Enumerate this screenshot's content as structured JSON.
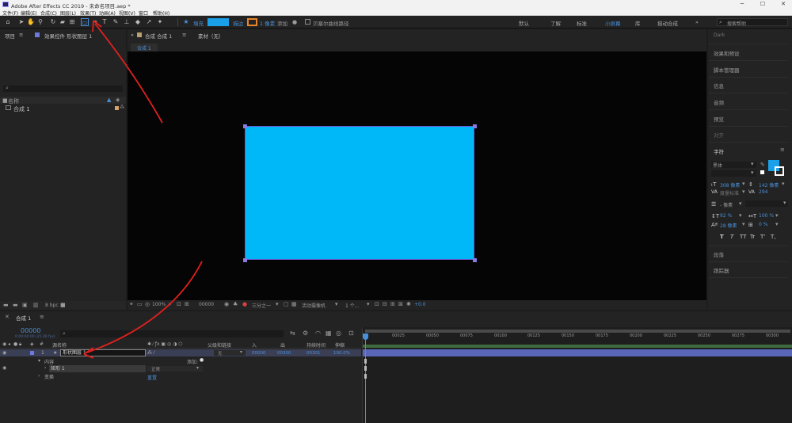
{
  "app": {
    "title": "Adobe After Effects CC 2019 - 未命名项目.aep *",
    "win_min": "─",
    "win_max": "☐",
    "win_close": "✕"
  },
  "menu": [
    "文件(F)",
    "编辑(E)",
    "合成(C)",
    "图层(L)",
    "效果(T)",
    "动画(A)",
    "视图(V)",
    "窗口",
    "帮助(H)"
  ],
  "toolbar": {
    "fill_label": "填充",
    "stroke_label": "描边",
    "stroke_width": "1 像素",
    "add_label": "添加",
    "bezier_label": "贝塞尔曲线路径",
    "fill_color": "#1aa0e8",
    "stroke_color": "#e8852a",
    "workspaces": [
      "默认",
      "了解",
      "标准",
      "小屏幕",
      "库",
      "摇动合成"
    ],
    "active_workspace": "小屏幕",
    "more": "»",
    "search_placeholder": "搜索帮助"
  },
  "project_panel": {
    "tab": "项目",
    "tab2": "效果控件 形状图层 1",
    "search_icon": "⌕",
    "col_name": "名称",
    "item": "合成 1",
    "bpc": "8 bpc"
  },
  "comp_panel": {
    "tab": "合成 合成 1",
    "tab_menu": "≡",
    "footage_tab": "素材（无）",
    "sub_tab": "合成 1",
    "zoom": "100%",
    "timecode": "00000",
    "resolution": "三分之一",
    "camera": "活动摄像机",
    "views": "1 个...",
    "exposure": "+0.0",
    "shape_color": "#00b8f8"
  },
  "right_panel": {
    "header": "Dark",
    "items": [
      "效果和预设",
      "脚本管理器",
      "信息",
      "音频",
      "预览",
      "对齐"
    ],
    "char_title": "字符",
    "font": "黑体",
    "size": "308 像素",
    "leading": "142 像素",
    "kerning": "度量标准",
    "tracking": "294",
    "stroke_width": "- 像素",
    "vscale": "92 %",
    "hscale": "100 %",
    "baseline": "28 像素",
    "tsume": "0 %",
    "styles": [
      "T",
      "T",
      "TT",
      "Tr",
      "T'",
      "T,"
    ],
    "para": "段落",
    "tracker": "跟踪器",
    "fill_color": "#1aa0e8"
  },
  "timeline": {
    "tab": "合成 1",
    "timecode": "00000",
    "fps": "0:00:00:00 (25.00 fps)",
    "search_icon": "⌕",
    "col_source": "源名称",
    "col_parent": "父级和链接",
    "col_in": "入",
    "col_out": "出",
    "col_duration": "持续时间",
    "col_stretch": "伸缩",
    "layer_num": "1",
    "layer_star": "★",
    "layer_name": "形状图层 1",
    "parent_value": "无",
    "in_val": "00000",
    "out_val": "00300",
    "dur_val": "00301",
    "stretch_val": "100.0%",
    "contents": "内容",
    "add_label": "添加:",
    "rect": "矩形 1",
    "blend": "正常",
    "transform": "变换",
    "reset": "重置",
    "ruler": [
      "00025",
      "00050",
      "00075",
      "00100",
      "00125",
      "00150",
      "00175",
      "00200",
      "00225",
      "00250",
      "00275",
      "00300"
    ]
  }
}
